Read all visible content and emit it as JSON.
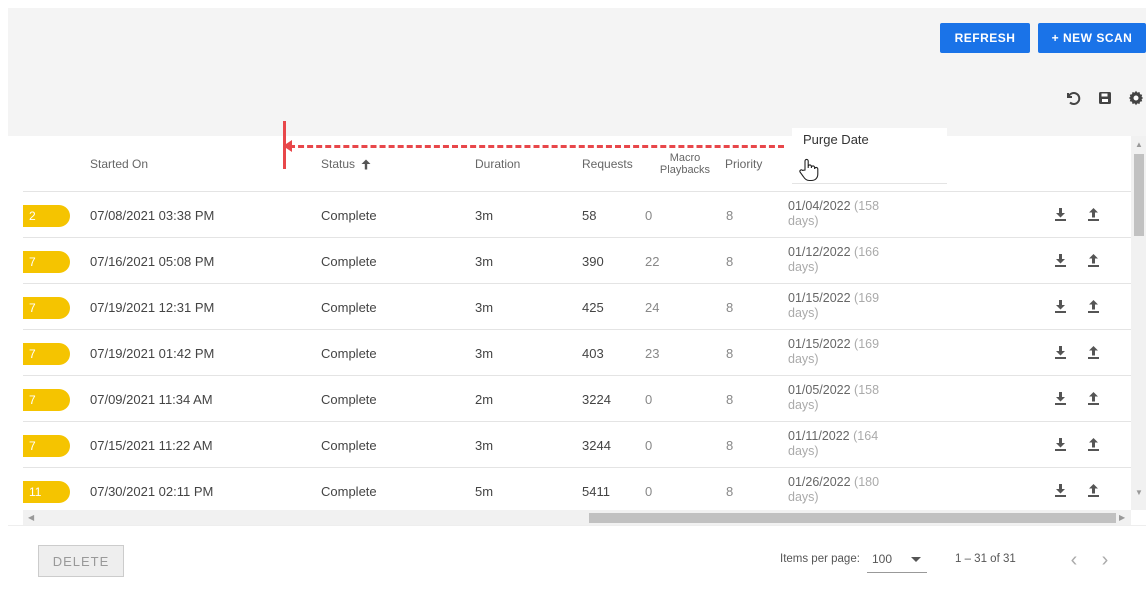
{
  "toolbar": {
    "refresh_label": "REFRESH",
    "new_scan_label": "+ NEW SCAN",
    "icons": [
      "undo-icon",
      "save-icon",
      "gear-icon"
    ]
  },
  "table": {
    "headers": {
      "started_on": "Started On",
      "status": "Status",
      "duration": "Duration",
      "requests": "Requests",
      "macro_line1": "Macro",
      "macro_line2": "Playbacks",
      "priority": "Priority",
      "purge_date": "Purge Date"
    },
    "rows": [
      {
        "badge": "2",
        "started": "07/08/2021 03:38 PM",
        "status": "Complete",
        "duration": "3m",
        "requests": "58",
        "macro": "0",
        "priority": "8",
        "purge_date": "01/04/2022",
        "purge_days_a": "(158",
        "purge_days_b": "days)"
      },
      {
        "badge": "7",
        "started": "07/16/2021 05:08 PM",
        "status": "Complete",
        "duration": "3m",
        "requests": "390",
        "macro": "22",
        "priority": "8",
        "purge_date": "01/12/2022",
        "purge_days_a": "(166",
        "purge_days_b": "days)"
      },
      {
        "badge": "7",
        "started": "07/19/2021 12:31 PM",
        "status": "Complete",
        "duration": "3m",
        "requests": "425",
        "macro": "24",
        "priority": "8",
        "purge_date": "01/15/2022",
        "purge_days_a": "(169",
        "purge_days_b": "days)"
      },
      {
        "badge": "7",
        "started": "07/19/2021 01:42 PM",
        "status": "Complete",
        "duration": "3m",
        "requests": "403",
        "macro": "23",
        "priority": "8",
        "purge_date": "01/15/2022",
        "purge_days_a": "(169",
        "purge_days_b": "days)"
      },
      {
        "badge": "7",
        "started": "07/09/2021 11:34 AM",
        "status": "Complete",
        "duration": "2m",
        "requests": "3224",
        "macro": "0",
        "priority": "8",
        "purge_date": "01/05/2022",
        "purge_days_a": "(158",
        "purge_days_b": "days)"
      },
      {
        "badge": "7",
        "started": "07/15/2021 11:22 AM",
        "status": "Complete",
        "duration": "3m",
        "requests": "3244",
        "macro": "0",
        "priority": "8",
        "purge_date": "01/11/2022",
        "purge_days_a": "(164",
        "purge_days_b": "days)"
      },
      {
        "badge": "11",
        "started": "07/30/2021 02:11 PM",
        "status": "Complete",
        "duration": "5m",
        "requests": "5411",
        "macro": "0",
        "priority": "8",
        "purge_date": "01/26/2022",
        "purge_days_a": "(180",
        "purge_days_b": "days)"
      }
    ]
  },
  "footer": {
    "delete_label": "DELETE",
    "items_per_page_label": "Items per page:",
    "items_per_page_value": "100",
    "range_label": "1 – 31 of 31"
  },
  "colors": {
    "accent": "#1a73e8",
    "badge": "#f5c400",
    "drag_indicator": "#e8474a"
  }
}
